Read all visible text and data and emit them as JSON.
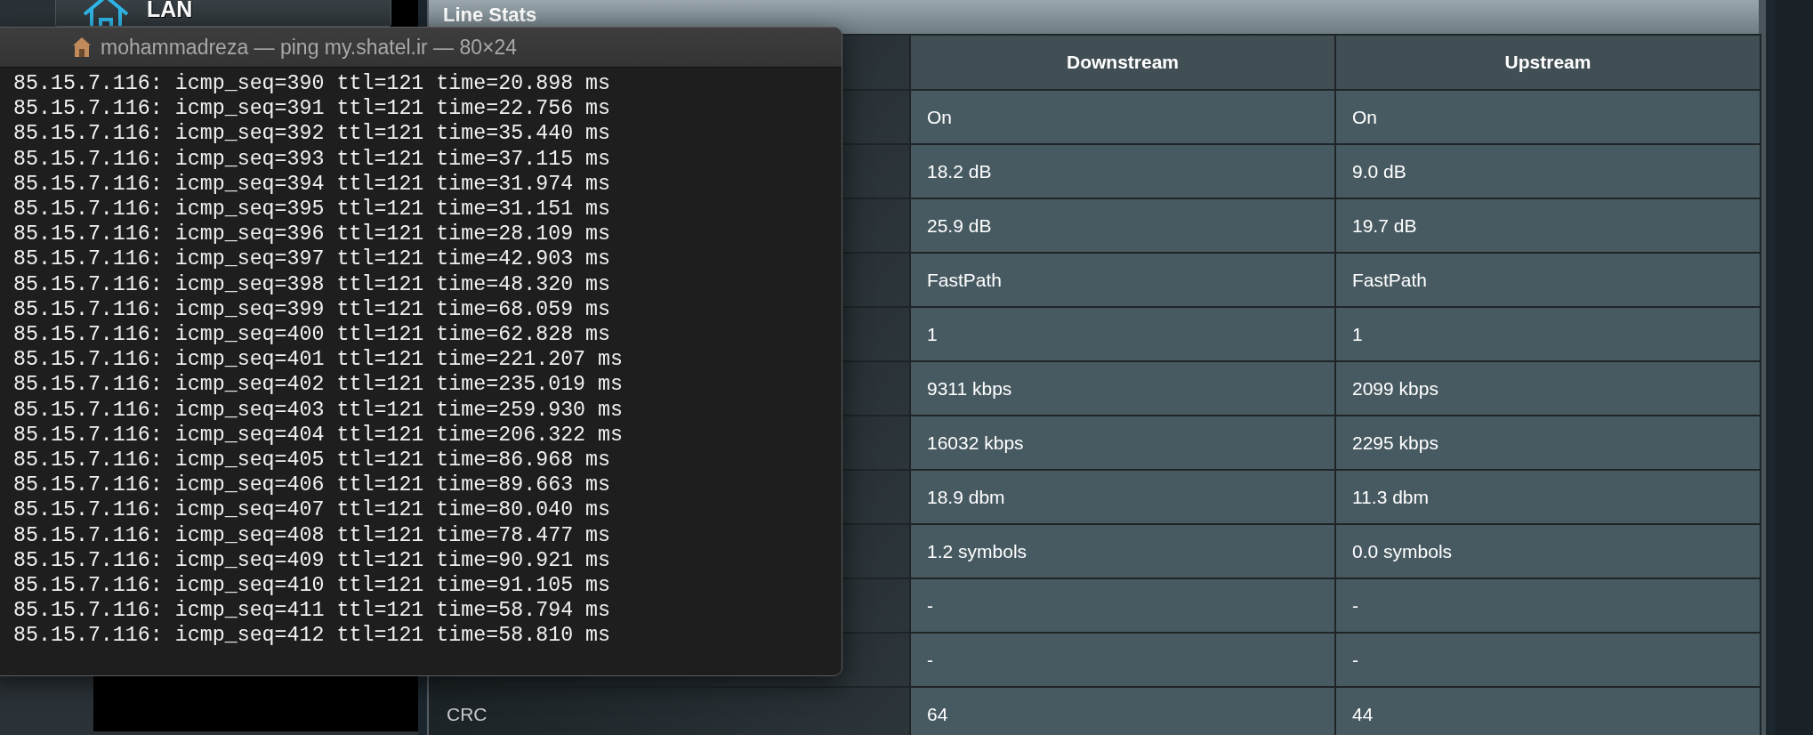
{
  "sidebar": {
    "items": [
      {
        "label": "LAN"
      }
    ]
  },
  "panel": {
    "title": "Line Stats",
    "table": {
      "columns": [
        "Downstream",
        "Upstream"
      ],
      "rows": [
        {
          "downstream": "On",
          "upstream": "On"
        },
        {
          "downstream": "18.2 dB",
          "upstream": "9.0 dB"
        },
        {
          "downstream": "25.9 dB",
          "upstream": "19.7 dB"
        },
        {
          "downstream": "FastPath",
          "upstream": "FastPath"
        },
        {
          "downstream": "1",
          "upstream": "1"
        },
        {
          "downstream": "9311 kbps",
          "upstream": "2099 kbps"
        },
        {
          "downstream": "16032 kbps",
          "upstream": "2295 kbps"
        },
        {
          "downstream": "18.9 dbm",
          "upstream": "11.3 dbm"
        },
        {
          "downstream": "1.2 symbols",
          "upstream": "0.0 symbols"
        },
        {
          "downstream": "-",
          "upstream": "-"
        },
        {
          "downstream": "-",
          "upstream": "-"
        },
        {
          "label": "CRC",
          "downstream": "64",
          "upstream": "44"
        }
      ]
    }
  },
  "terminal": {
    "title": "mohammadreza — ping my.shatel.ir — 80×24",
    "lines": [
      "85.15.7.116: icmp_seq=390 ttl=121 time=20.898 ms",
      "85.15.7.116: icmp_seq=391 ttl=121 time=22.756 ms",
      "85.15.7.116: icmp_seq=392 ttl=121 time=35.440 ms",
      "85.15.7.116: icmp_seq=393 ttl=121 time=37.115 ms",
      "85.15.7.116: icmp_seq=394 ttl=121 time=31.974 ms",
      "85.15.7.116: icmp_seq=395 ttl=121 time=31.151 ms",
      "85.15.7.116: icmp_seq=396 ttl=121 time=28.109 ms",
      "85.15.7.116: icmp_seq=397 ttl=121 time=42.903 ms",
      "85.15.7.116: icmp_seq=398 ttl=121 time=48.320 ms",
      "85.15.7.116: icmp_seq=399 ttl=121 time=68.059 ms",
      "85.15.7.116: icmp_seq=400 ttl=121 time=62.828 ms",
      "85.15.7.116: icmp_seq=401 ttl=121 time=221.207 ms",
      "85.15.7.116: icmp_seq=402 ttl=121 time=235.019 ms",
      "85.15.7.116: icmp_seq=403 ttl=121 time=259.930 ms",
      "85.15.7.116: icmp_seq=404 ttl=121 time=206.322 ms",
      "85.15.7.116: icmp_seq=405 ttl=121 time=86.968 ms",
      "85.15.7.116: icmp_seq=406 ttl=121 time=89.663 ms",
      "85.15.7.116: icmp_seq=407 ttl=121 time=80.040 ms",
      "85.15.7.116: icmp_seq=408 ttl=121 time=78.477 ms",
      "85.15.7.116: icmp_seq=409 ttl=121 time=90.921 ms",
      "85.15.7.116: icmp_seq=410 ttl=121 time=91.105 ms",
      "85.15.7.116: icmp_seq=411 ttl=121 time=58.794 ms",
      "85.15.7.116: icmp_seq=412 ttl=121 time=58.810 ms"
    ]
  }
}
